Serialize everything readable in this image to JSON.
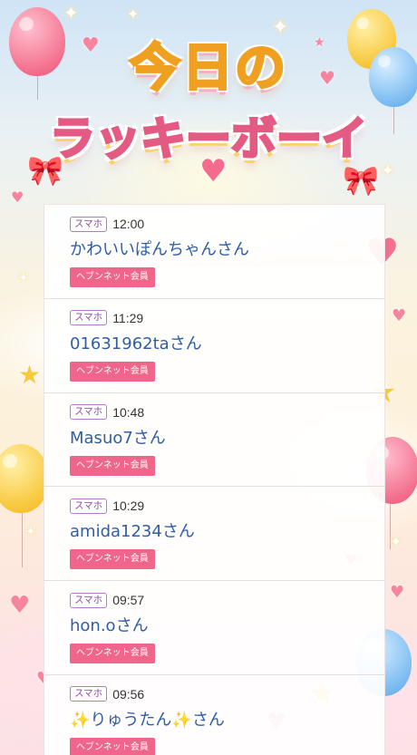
{
  "title": {
    "line1": "今日の",
    "line2": "ラッキーボーイ"
  },
  "entries": [
    {
      "device": "スマホ",
      "time": "12:00",
      "name": "かわいいぽんちゃんさん",
      "badge": "ヘブンネット会員"
    },
    {
      "device": "スマホ",
      "time": "11:29",
      "name": "01631962taさん",
      "badge": "ヘブンネット会員"
    },
    {
      "device": "スマホ",
      "time": "10:48",
      "name": "Masuo7さん",
      "badge": "ヘブンネット会員"
    },
    {
      "device": "スマホ",
      "time": "10:29",
      "name": "amida1234さん",
      "badge": "ヘブンネット会員"
    },
    {
      "device": "スマホ",
      "time": "09:57",
      "name": "hon.oさん",
      "badge": "ヘブンネット会員"
    },
    {
      "device": "スマホ",
      "time": "09:56",
      "name": "✨りゅうたん✨さん",
      "badge": "ヘブンネット会員"
    }
  ],
  "colors": {
    "name_text": "#2f5ea5",
    "member_badge": "#f0668a",
    "device_badge_border": "#b07cc4",
    "title_yellow": "#ffd65a",
    "title_pink": "#f27e9c"
  },
  "icons": [
    "balloon-icon",
    "heart-icon",
    "star-icon",
    "sparkle-icon",
    "ribbon-bow-icon"
  ]
}
